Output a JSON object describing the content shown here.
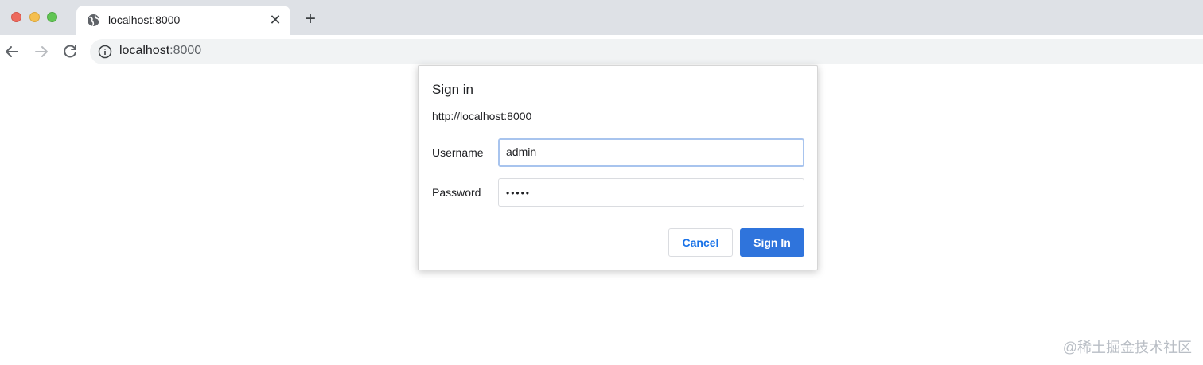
{
  "window": {
    "controls": [
      "close",
      "minimize",
      "maximize"
    ]
  },
  "tab": {
    "favicon": "globe-icon",
    "title": "localhost:8000",
    "close_icon": "close-icon"
  },
  "new_tab_icon": "plus-icon",
  "toolbar": {
    "back_icon": "arrow-left-icon",
    "forward_icon": "arrow-right-icon",
    "reload_icon": "reload-icon",
    "site_info_icon": "info-icon",
    "url_host": "localhost",
    "url_port": ":8000"
  },
  "dialog": {
    "title": "Sign in",
    "origin": "http://localhost:8000",
    "username_label": "Username",
    "username_value": "admin",
    "password_label": "Password",
    "password_value": "•••••",
    "cancel_label": "Cancel",
    "signin_label": "Sign In"
  },
  "watermark": "@稀土掘金技术社区",
  "colors": {
    "accent": "#2f74dc",
    "link": "#1a73e8",
    "tabstrip": "#dee1e6"
  }
}
